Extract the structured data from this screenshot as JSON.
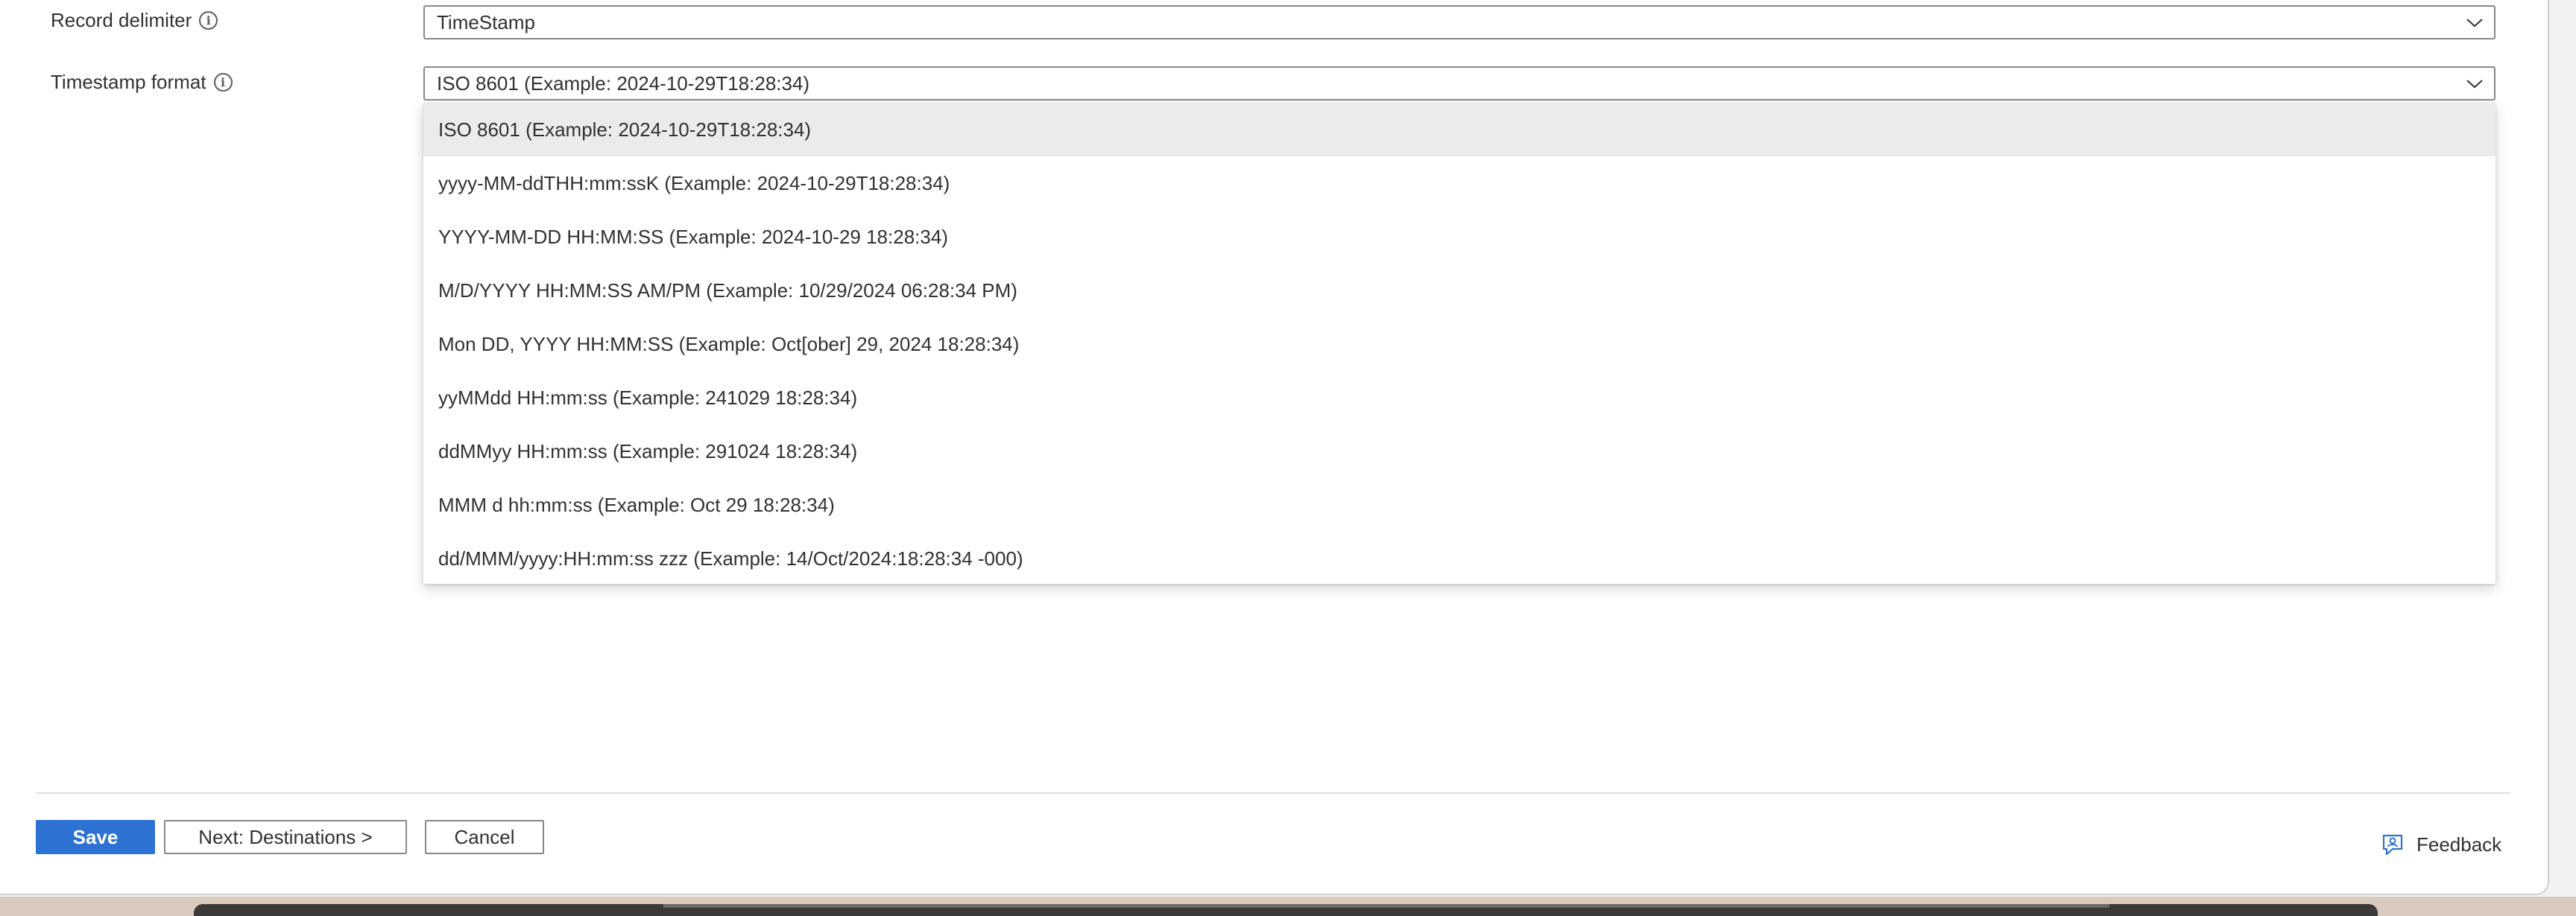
{
  "form": {
    "record_delimiter": {
      "label": "Record delimiter",
      "value": "TimeStamp"
    },
    "timestamp_format": {
      "label": "Timestamp format",
      "value": "ISO 8601 (Example: 2024-10-29T18:28:34)",
      "options": [
        "ISO 8601 (Example: 2024-10-29T18:28:34)",
        "yyyy-MM-ddTHH:mm:ssK (Example: 2024-10-29T18:28:34)",
        "YYYY-MM-DD HH:MM:SS (Example: 2024-10-29 18:28:34)",
        "M/D/YYYY HH:MM:SS AM/PM (Example: 10/29/2024 06:28:34 PM)",
        "Mon DD, YYYY HH:MM:SS (Example: Oct[ober] 29, 2024 18:28:34)",
        "yyMMdd HH:mm:ss (Example: 241029 18:28:34)",
        "ddMMyy HH:mm:ss (Example: 291024 18:28:34)",
        "MMM d hh:mm:ss (Example: Oct 29 18:28:34)",
        "dd/MMM/yyyy:HH:mm:ss zzz (Example: 14/Oct/2024:18:28:34 -000)"
      ],
      "selected_index": 0
    }
  },
  "footer": {
    "save_label": "Save",
    "next_label": "Next: Destinations >",
    "cancel_label": "Cancel",
    "feedback_label": "Feedback"
  },
  "icons": {
    "info": "info-icon",
    "chevron": "chevron-down-icon",
    "feedback": "feedback-icon"
  },
  "colors": {
    "primary": "#2d72d2",
    "selected_option_bg": "#edebe9"
  }
}
